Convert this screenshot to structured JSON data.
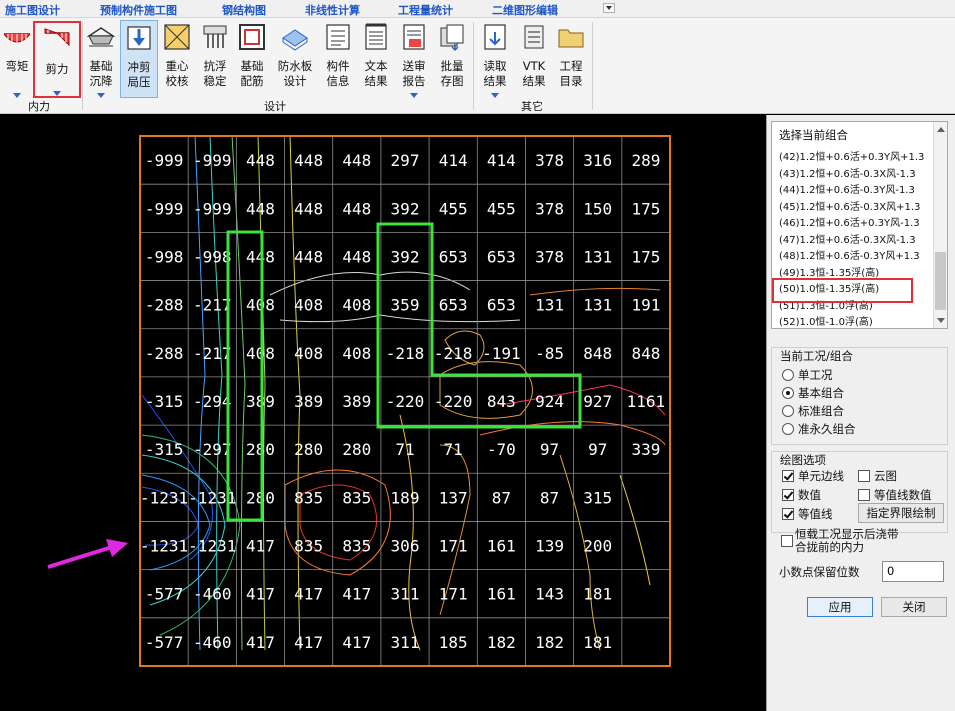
{
  "menu": {
    "items": [
      "施工图设计",
      "预制构件施工图",
      "钢结构图",
      "非线性计算",
      "工程量统计",
      "二维图形编辑"
    ]
  },
  "ribbon": {
    "groups": {
      "internal_force": "内力",
      "design": "设计",
      "other": "其它"
    },
    "buttons": [
      {
        "key": "bending",
        "label": "弯矩"
      },
      {
        "key": "shear",
        "label": "剪力"
      },
      {
        "key": "settlement",
        "label": "基础\n沉降"
      },
      {
        "key": "punching",
        "label": "冲剪\n局压"
      },
      {
        "key": "centroid",
        "label": "重心\n校核"
      },
      {
        "key": "anti_float",
        "label": "抗浮\n稳定"
      },
      {
        "key": "reinforcement",
        "label": "基础\n配筋"
      },
      {
        "key": "waterproof",
        "label": "防水板\n设计"
      },
      {
        "key": "member_info",
        "label": "构件\n信息"
      },
      {
        "key": "text_result",
        "label": "文本\n结果"
      },
      {
        "key": "review_report",
        "label": "送审\n报告"
      },
      {
        "key": "batch_save",
        "label": "批量\n存图"
      },
      {
        "key": "read_result",
        "label": "读取\n结果"
      },
      {
        "key": "vtk_result",
        "label": "VTK\n结果"
      },
      {
        "key": "project_dir",
        "label": "工程\n目录"
      }
    ]
  },
  "grid": {
    "rows": [
      [
        "-999",
        "-999",
        "448",
        "448",
        "448",
        "297",
        "414",
        "414",
        "378",
        "316",
        "289"
      ],
      [
        "-999",
        "-999",
        "448",
        "448",
        "448",
        "392",
        "455",
        "455",
        "378",
        "150",
        "175"
      ],
      [
        "-998",
        "-998",
        "448",
        "448",
        "448",
        "392",
        "653",
        "653",
        "378",
        "131",
        "175"
      ],
      [
        "-288",
        "-217",
        "408",
        "408",
        "408",
        "359",
        "653",
        "653",
        "131",
        "131",
        "191"
      ],
      [
        "-288",
        "-217",
        "408",
        "408",
        "408",
        "-218",
        "-218",
        "-191",
        "-85",
        "848",
        "848"
      ],
      [
        "-315",
        "-294",
        "389",
        "389",
        "389",
        "-220",
        "-220",
        "843",
        "924",
        "927",
        "1161"
      ],
      [
        "-315",
        "-297",
        "280",
        "280",
        "280",
        "71",
        "71",
        "-70",
        "97",
        "97",
        "339"
      ],
      [
        "-1231",
        "-1231",
        "280",
        "835",
        "835",
        "189",
        "137",
        "87",
        "87",
        "315",
        ""
      ],
      [
        "-1231",
        "-1231",
        "417",
        "835",
        "835",
        "306",
        "171",
        "161",
        "139",
        "200",
        ""
      ],
      [
        "-577",
        "-460",
        "417",
        "417",
        "417",
        "311",
        "171",
        "161",
        "143",
        "181",
        ""
      ],
      [
        "-577",
        "-460",
        "417",
        "417",
        "417",
        "311",
        "185",
        "182",
        "182",
        "181",
        ""
      ]
    ]
  },
  "panel": {
    "combo_title": "选择当前组合",
    "combos": [
      "(42)1.2恒+0.6活+0.3Y风+1.3",
      "(43)1.2恒+0.6活-0.3X风-1.3",
      "(44)1.2恒+0.6活-0.3Y风-1.3",
      "(45)1.2恒+0.6活-0.3X风+1.3",
      "(46)1.2恒+0.6活+0.3Y风-1.3",
      "(47)1.2恒+0.6活-0.3X风-1.3",
      "(48)1.2恒+0.6活-0.3Y风+1.3",
      "(49)1.3恒-1.35浮(高)",
      "(50)1.0恒-1.35浮(高)",
      "(51)1.3恒-1.0浮(高)",
      "(52)1.0恒-1.0浮(高)"
    ],
    "selected_combo_index": 8,
    "case_title": "当前工况/组合",
    "case_options": [
      "单工况",
      "基本组合",
      "标准组合",
      "准永久组合"
    ],
    "case_selected_index": 1,
    "draw_title": "绘图选项",
    "draw_options": [
      {
        "label": "单元边线",
        "checked": true
      },
      {
        "label": "云图",
        "checked": false
      },
      {
        "label": "数值",
        "checked": true
      },
      {
        "label": "等值线数值",
        "checked": false
      },
      {
        "label": "等值线",
        "checked": true
      }
    ],
    "boundary_button": "指定界限绘制",
    "post_pour_label": "恒载工况显示后浇带\n合拢前的内力",
    "post_pour_checked": false,
    "decimal_label": "小数点保留位数",
    "decimal_value": "0",
    "apply_button": "应用",
    "close_button": "关闭"
  },
  "colors": {
    "accent": "#2d64c8",
    "highlight_red": "#e0303a",
    "grid_border": "#e07a18",
    "grid_line": "#9a9a9a",
    "column_green": "#3be43b",
    "arrow_magenta": "#e028e0"
  }
}
